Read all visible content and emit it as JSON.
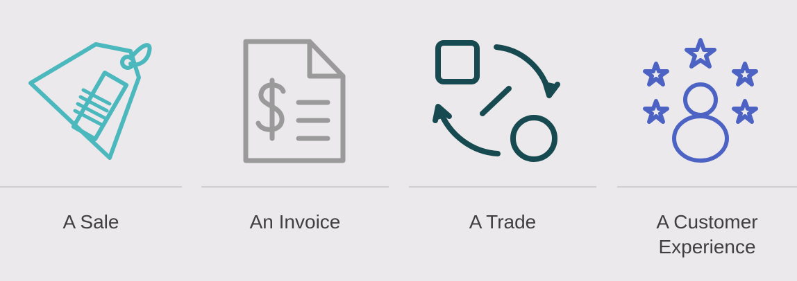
{
  "items": [
    {
      "label": "A Sale",
      "icon": "price-tag-icon",
      "color": "#4bb8be"
    },
    {
      "label": "An Invoice",
      "icon": "invoice-dollar-icon",
      "color": "#9a9a9a"
    },
    {
      "label": "A Trade",
      "icon": "exchange-shapes-icon",
      "color": "#174a50"
    },
    {
      "label": "A Customer Experience",
      "icon": "customer-stars-icon",
      "color": "#4d63c4"
    }
  ],
  "divider_color": "#cfcdd0"
}
